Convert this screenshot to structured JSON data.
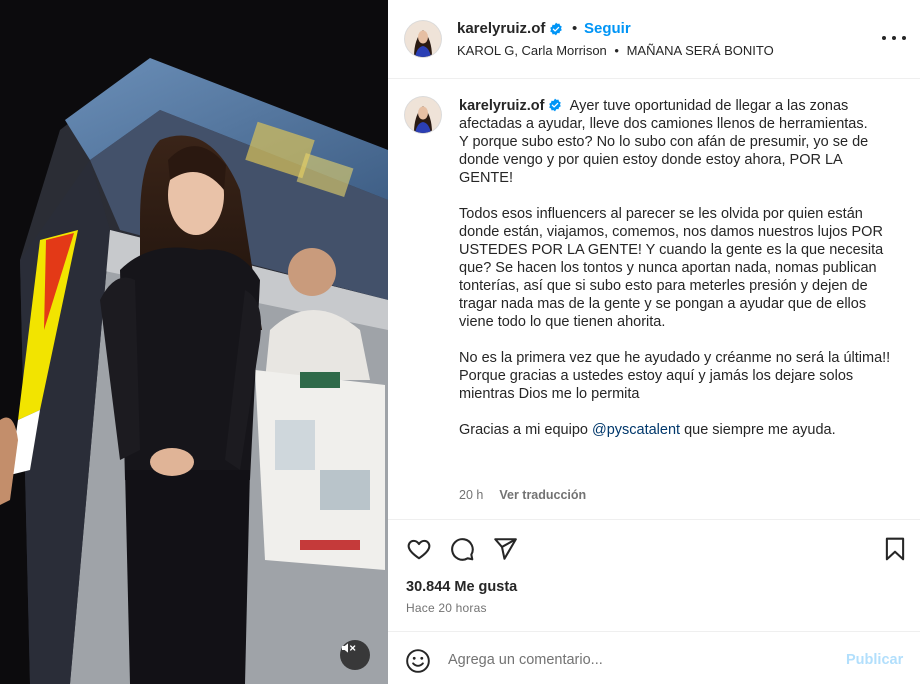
{
  "header": {
    "username": "karelyruiz.of",
    "separator": "•",
    "follow_label": "Seguir",
    "music_artists": "KAROL G, Carla Morrison",
    "music_separator": "•",
    "music_title": "MAÑANA SERÁ BONITO"
  },
  "caption": {
    "username": "karelyruiz.of",
    "paragraph1": "Ayer tuve oportunidad de llegar a las zonas afectadas a ayudar, lleve dos camiones llenos de herramientas.",
    "paragraph1b": "Y porque subo esto? No lo subo con afán de presumir, yo se de donde vengo y por quien estoy donde estoy ahora, POR LA GENTE!",
    "paragraph2": "Todos esos influencers al parecer se les olvida por quien están donde están, viajamos, comemos, nos damos nuestros lujos POR USTEDES POR LA GENTE! Y cuando la gente es la que necesita que? Se hacen los tontos y nunca aportan nada, nomas publican tonterías, así que si subo esto para meterles presión y dejen de tragar nada mas de la gente y se pongan a ayudar que de ellos viene todo lo que tienen ahorita.",
    "paragraph3": "No es la primera vez que he ayudado y créanme no será la última!! Porque gracias a ustedes estoy aquí y jamás los dejare solos mientras Dios me lo permita",
    "paragraph4_prefix": "Gracias a mi equipo ",
    "mention": "@pyscatalent",
    "paragraph4_suffix": " que siempre me ayuda.",
    "time": "20 h",
    "translate_label": "Ver traducción"
  },
  "stats": {
    "likes": "30.844 Me gusta",
    "posted_ago": "Hace 20 horas"
  },
  "comment": {
    "placeholder": "Agrega un comentario...",
    "publish_label": "Publicar"
  },
  "icons": {
    "like": "heart-icon",
    "comment": "comment-icon",
    "share": "send-icon",
    "save": "bookmark-icon",
    "emoji": "emoji-icon",
    "mute": "mute-icon",
    "verified": "verified-badge-icon",
    "more": "more-options-icon"
  },
  "colors": {
    "accent": "#0095f6",
    "verified": "#0095f6",
    "publish_disabled": "#b2dffc",
    "secondary_text": "#737373"
  }
}
